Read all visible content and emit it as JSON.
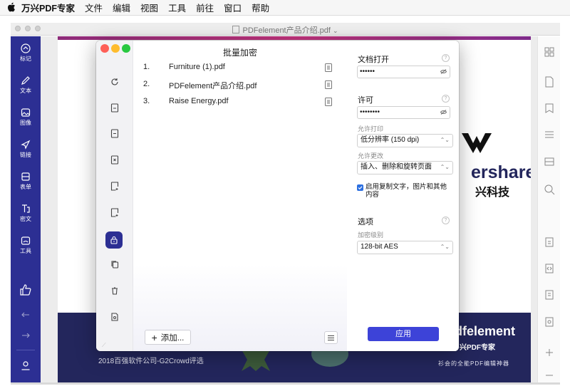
{
  "menubar": {
    "app": "万兴PDF专家",
    "items": [
      "文件",
      "编辑",
      "视图",
      "工具",
      "前往",
      "窗口",
      "帮助"
    ]
  },
  "window": {
    "title": "PDFelement产品介绍.pdf"
  },
  "left_toolbar": {
    "items": [
      {
        "label": "标记",
        "icon": "markup-icon"
      },
      {
        "label": "文本",
        "icon": "pen-icon"
      },
      {
        "label": "图像",
        "icon": "image-icon"
      },
      {
        "label": "链接",
        "icon": "link-icon"
      },
      {
        "label": "表单",
        "icon": "form-icon"
      },
      {
        "label": "密文",
        "icon": "redact-icon"
      },
      {
        "label": "工具",
        "icon": "tools-icon"
      }
    ]
  },
  "document": {
    "brand_fragment": "ershare",
    "brand_cn": "兴科技",
    "footer_left": "2018百强软件公司-G2Crowd评选",
    "footer_product": "dfelement",
    "footer_product_cn": "兴PDF专家",
    "footer_slogan": "衫会的全能PDF编辑神器"
  },
  "dialog": {
    "title": "批量加密",
    "files": [
      {
        "no": "1.",
        "name": "Furniture (1).pdf"
      },
      {
        "no": "2.",
        "name": "PDFelement产品介绍.pdf"
      },
      {
        "no": "3.",
        "name": "Raise Energy.pdf"
      }
    ],
    "add_label": "添加...",
    "settings": {
      "open_title": "文档打开",
      "open_password": "••••••",
      "permission_title": "许可",
      "permission_password": "••••••••",
      "print_label": "允许打印",
      "print_value": "低分辨率 (150 dpi)",
      "change_label": "允许更改",
      "change_value": "插入、删除和旋转页面",
      "copy_label": "启用复制文字，图片和其他内容",
      "options_title": "选项",
      "encrypt_label": "加密级别",
      "encrypt_value": "128-bit AES",
      "apply_label": "应用"
    }
  },
  "colors": {
    "accent": "#2c2f93",
    "apply": "#3d43d8",
    "navy_band": "#23265c"
  }
}
